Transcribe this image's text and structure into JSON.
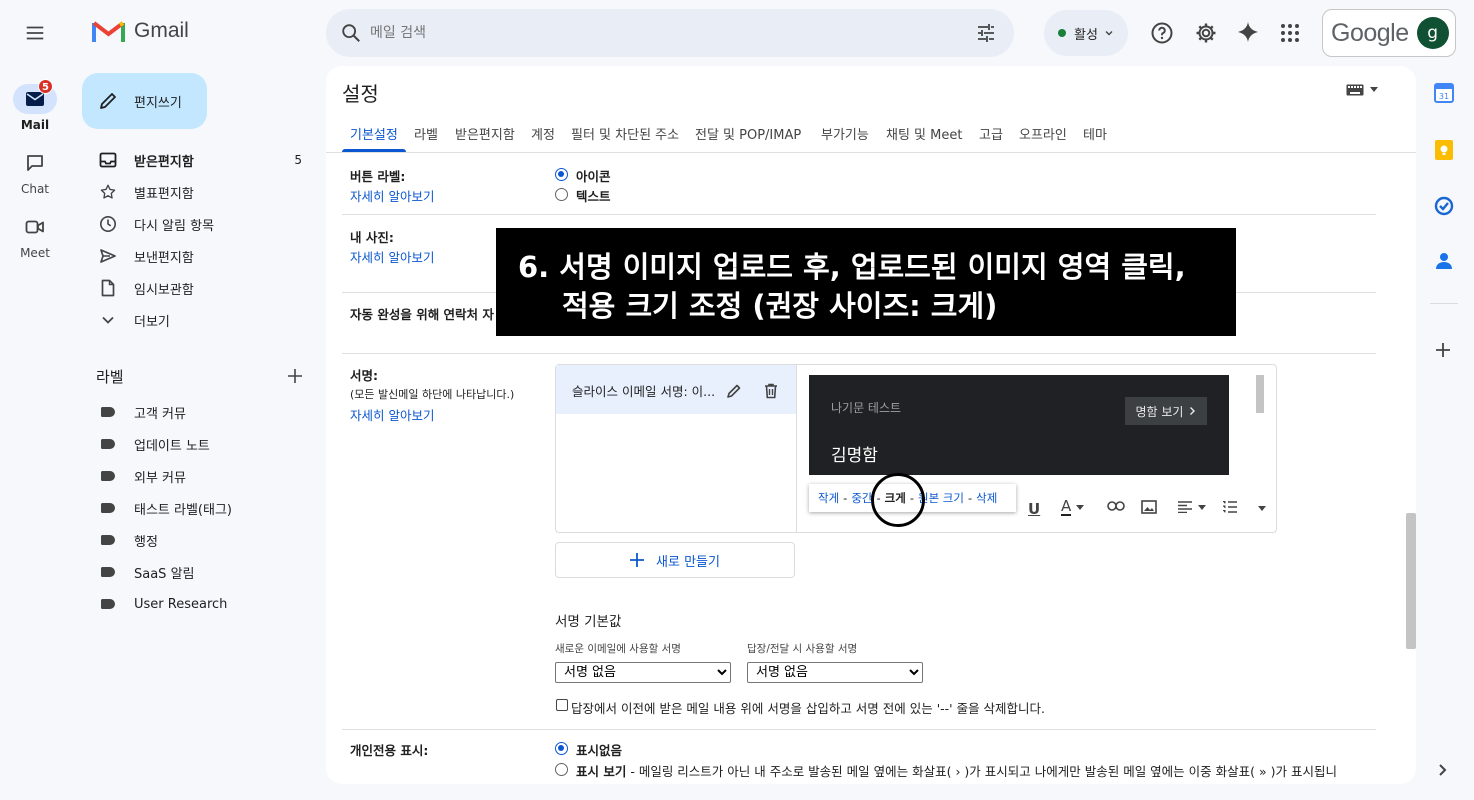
{
  "app": {
    "name": "Gmail"
  },
  "search": {
    "placeholder": "메일 검색"
  },
  "status": {
    "label": "활성"
  },
  "account": {
    "brand": "Google",
    "avatar_letter": "g"
  },
  "rail": {
    "mail": {
      "label": "Mail",
      "badge": "5"
    },
    "chat": {
      "label": "Chat"
    },
    "meet": {
      "label": "Meet"
    }
  },
  "compose": {
    "label": "편지쓰기"
  },
  "nav": [
    {
      "label": "받은편지함",
      "count": "5"
    },
    {
      "label": "별표편지함"
    },
    {
      "label": "다시 알림 항목"
    },
    {
      "label": "보낸편지함"
    },
    {
      "label": "임시보관함"
    },
    {
      "label": "더보기"
    }
  ],
  "labels_header": "라벨",
  "labels": [
    "고객 커뮤",
    "업데이트 노트",
    "외부 커뮤",
    "태스트 라벨(태그)",
    "행정",
    "SaaS 알림",
    "User Research"
  ],
  "settings": {
    "title": "설정",
    "tabs": [
      "기본설정",
      "라벨",
      "받은편지함",
      "계정",
      "필터 및 차단된 주소",
      "전달 및 POP/IMAP",
      "부가기능",
      "채팅 및 Meet",
      "고급",
      "오프라인",
      "테마"
    ],
    "button_labels": {
      "title": "버튼 라벨:",
      "link": "자세히 알아보기",
      "opt_icon": "아이콘",
      "opt_text": "텍스트"
    },
    "my_photo": {
      "title": "내 사진:",
      "link": "자세히 알아보기"
    },
    "autocomplete": {
      "title": "자동 완성을 위해 연락처 자"
    },
    "signature": {
      "title": "서명:",
      "desc": "(모든 발신메일 하단에 나타납니다.)",
      "link": "자세히 알아보기",
      "item_name": "슬라이스 이메일 서명: 이...",
      "preview_sub": "나기문 테스트",
      "preview_btn": "명함 보기",
      "preview_name": "김명함",
      "size_options": [
        "작게",
        "중간",
        "크게",
        "원본 크기",
        "삭제"
      ],
      "new_button": "새로 만들기",
      "defaults_title": "서명 기본값",
      "new_mail_label": "새로운 이메일에 사용할 서명",
      "reply_label": "답장/전달 시 사용할 서명",
      "new_mail_value": "서명 없음",
      "reply_value": "서명 없음",
      "insert_checkbox": "답장에서 이전에 받은 메일 내용 위에 서명을 삽입하고 서명 전에 있는 '--' 줄을 삭제합니다."
    },
    "personal_level": {
      "title": "개인전용 표시:",
      "opt_none": "표시없음",
      "opt_show": "표시 보기",
      "opt_show_desc": " - 메일링 리스트가 아닌 내 주소로 발송된 메일 옆에는 화살표( › )가 표시되고 나에게만 발송된 메일 옆에는 이중 화살표( » )가 표시됩니"
    }
  },
  "overlay": {
    "line1": "6. 서명 이미지 업로드 후, 업로드된 이미지 영역 클릭,",
    "line2": "적용 크기 조정 (권장 사이즈: 크게)"
  }
}
